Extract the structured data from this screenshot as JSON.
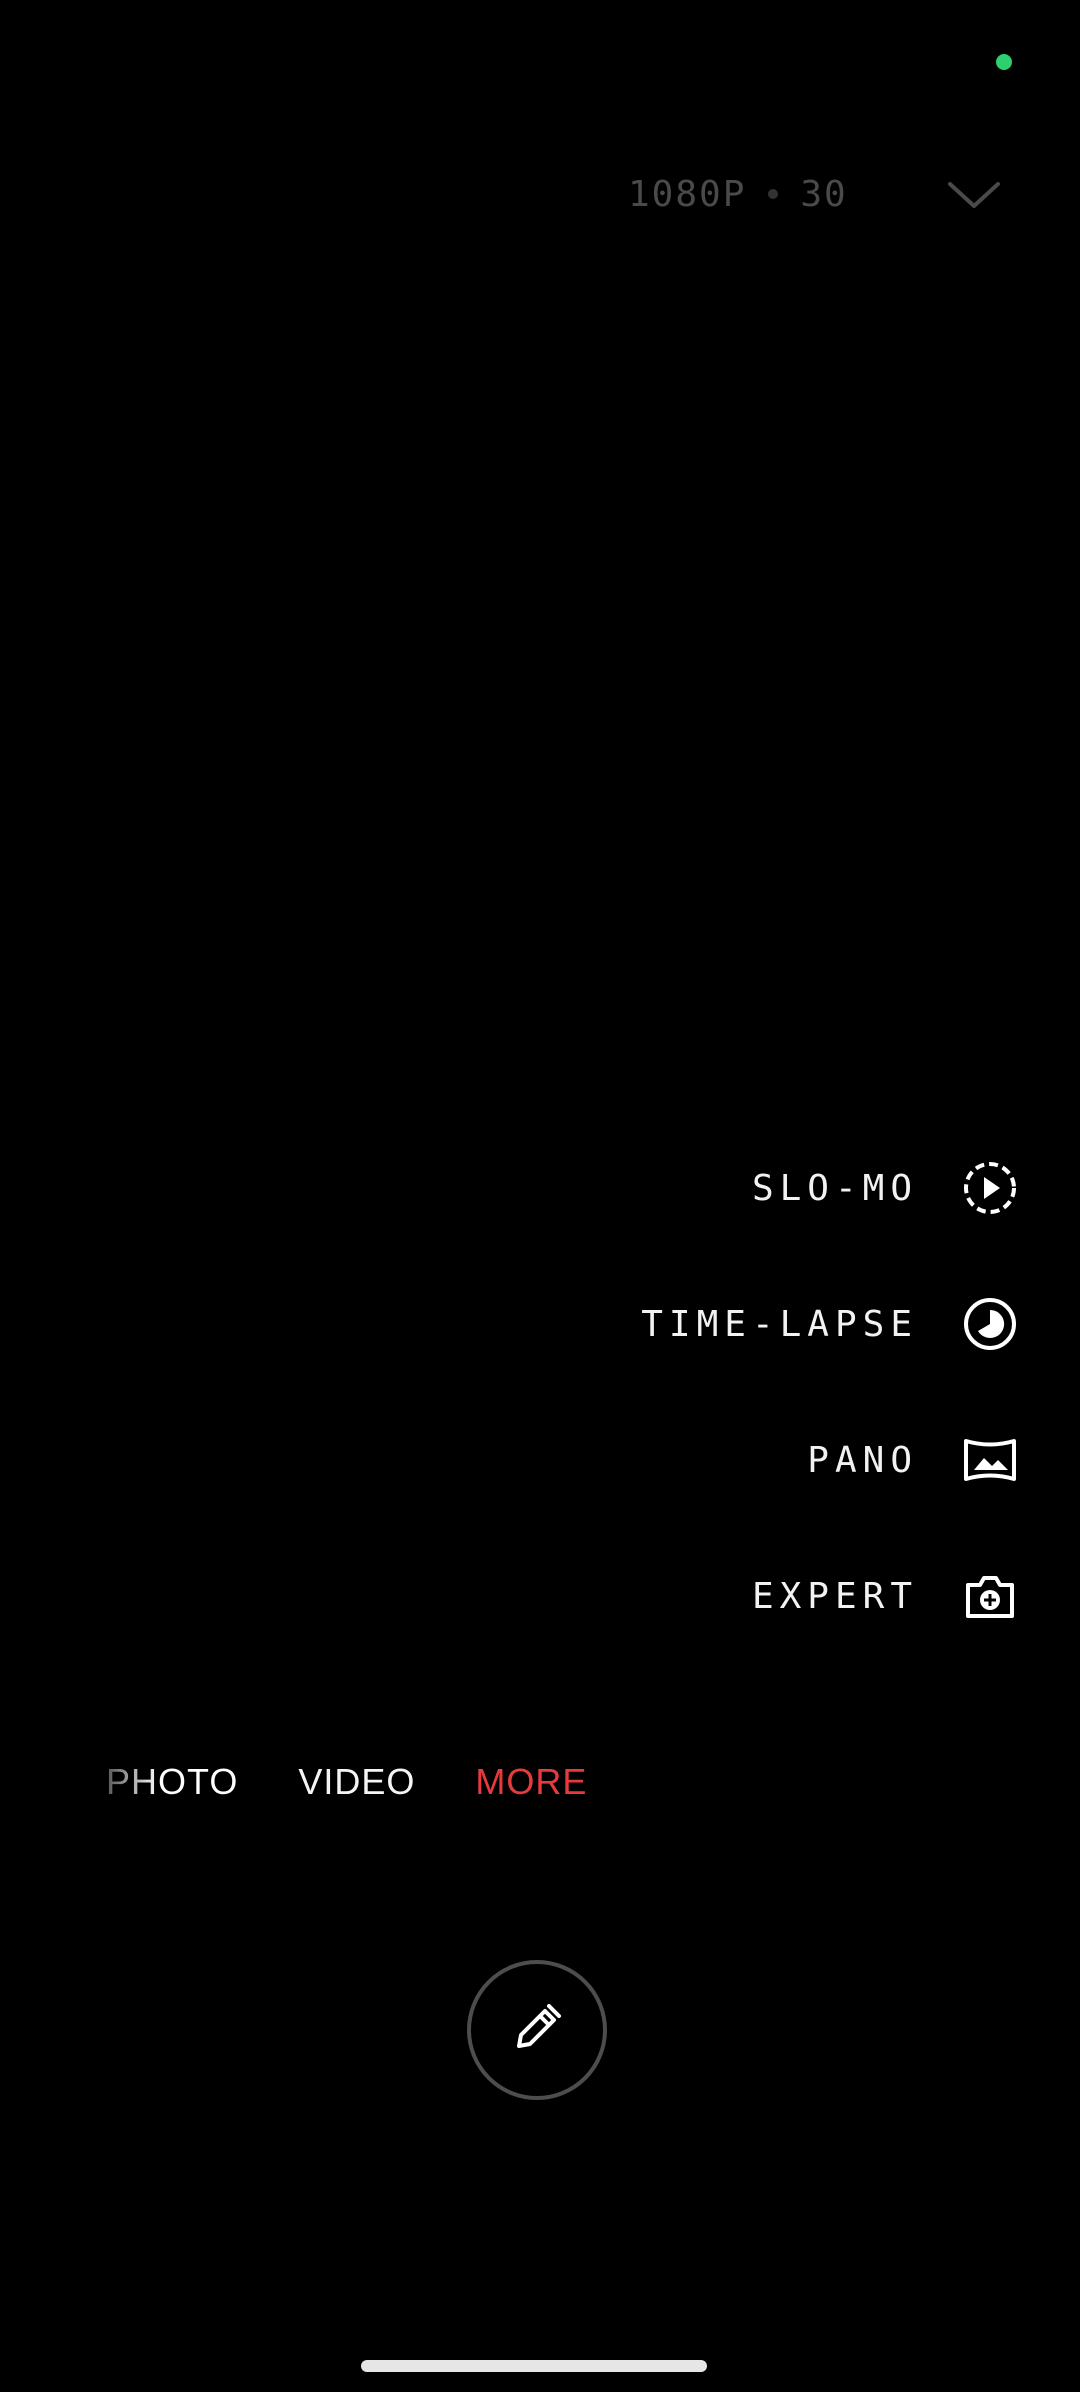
{
  "status": {
    "camera_indicator_color": "#2ecf6e"
  },
  "quality": {
    "resolution": "1080P",
    "frame_rate": "30",
    "toggle_icon": "chevron-down-icon"
  },
  "modes_menu": {
    "items": [
      {
        "label": "SLO-MO",
        "icon": "slow-motion-icon"
      },
      {
        "label": "TIME-LAPSE",
        "icon": "time-lapse-icon"
      },
      {
        "label": "PANO",
        "icon": "panorama-icon"
      },
      {
        "label": "EXPERT",
        "icon": "expert-camera-icon"
      }
    ]
  },
  "mode_tabs": {
    "photo": "PHOTO",
    "video": "VIDEO",
    "more": "MORE",
    "active": "MORE",
    "active_color": "#e8393c"
  },
  "shutter": {
    "icon": "edit-pencil-icon"
  }
}
